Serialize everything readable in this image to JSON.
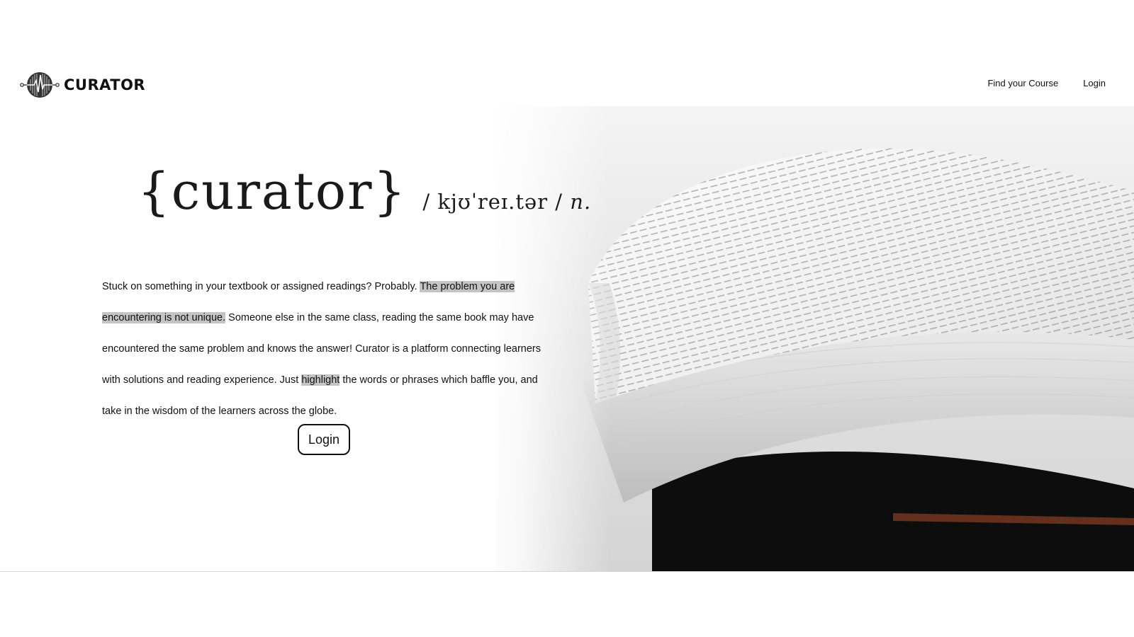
{
  "brand": {
    "name": "CURATOR",
    "logo_icon": "soundwave-circle-icon"
  },
  "nav": {
    "find_course": "Find your Course",
    "login": "Login"
  },
  "hero": {
    "word": "{curator}",
    "pronunciation": "/ kjʊˈreɪ.tər /",
    "part_of_speech": "n.",
    "intro": {
      "part1": "Stuck on something in your textbook or assigned readings? Probably. ",
      "highlight1": "The problem you are encountering is not unique.",
      "part2": " Someone else in the same class, reading the same book may have encountered the same problem and knows the answer! Curator is a platform connecting learners with solutions and reading experience. Just ",
      "highlight2": "highlight",
      "part3": " the words or phrases which baffle you, and take in the wisdom of the learners across the globe."
    },
    "cta_label": "Login",
    "highlight_color": "#c4c4c4",
    "background_image": "open-book-photo"
  }
}
